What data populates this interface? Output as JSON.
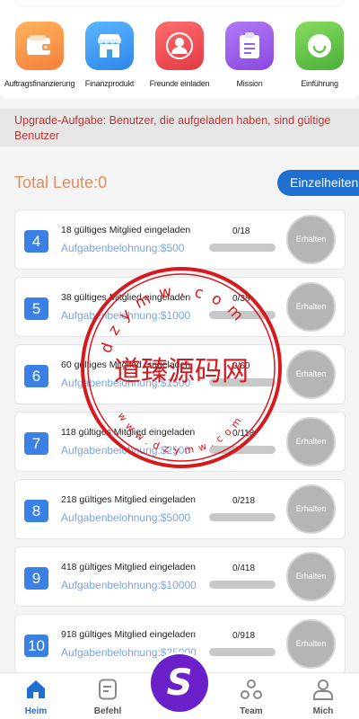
{
  "quick_actions": [
    {
      "label": "Auftragsfinanzierung",
      "icon": "wallet-icon",
      "color": "#f79a4a"
    },
    {
      "label": "Finanzprodukt",
      "icon": "store-icon",
      "color": "#3f9ef2"
    },
    {
      "label": "Freunde einladen",
      "icon": "person-icon",
      "color": "#ef4b52"
    },
    {
      "label": "Mission",
      "icon": "clipboard-icon",
      "color": "#9b5ce8"
    },
    {
      "label": "Einführung",
      "icon": "smile-icon",
      "color": "#62c24a"
    }
  ],
  "notice": "Upgrade-Aufgabe: Benutzer, die aufgeladen haben, sind gültige Benutzer",
  "total_label": "Total Leute:0",
  "details_label": "Einzelheiten",
  "tasks": [
    {
      "level": "4",
      "title": "18 gültiges Mitglied eingeladen",
      "reward": "Aufgabenbelohnung:$500",
      "progress": "0/18",
      "fraction": 0,
      "button": "Erhalten"
    },
    {
      "level": "5",
      "title": "38 gültiges Mitglied eingeladen",
      "reward": "Aufgabenbelohnung:$1000",
      "progress": "0/38",
      "fraction": 0,
      "button": "Erhalten"
    },
    {
      "level": "6",
      "title": "60 gültiges Mitglied eingeladen",
      "reward": "Aufgabenbelohnung:$1500",
      "progress": "0/60",
      "fraction": 0,
      "button": "Erhalten"
    },
    {
      "level": "7",
      "title": "118 gültiges Mitglied eingeladen",
      "reward": "Aufgabenbelohnung:$2500",
      "progress": "0/118",
      "fraction": 0,
      "button": "Erhalten"
    },
    {
      "level": "8",
      "title": "218 gültiges Mitglied eingeladen",
      "reward": "Aufgabenbelohnung:$5000",
      "progress": "0/218",
      "fraction": 0,
      "button": "Erhalten"
    },
    {
      "level": "9",
      "title": "418 gültiges Mitglied eingeladen",
      "reward": "Aufgabenbelohnung:$10000",
      "progress": "0/418",
      "fraction": 0,
      "button": "Erhalten"
    },
    {
      "level": "10",
      "title": "918 gültiges Mitglied eingeladen",
      "reward": "Aufgabenbelohnung:$25000",
      "progress": "0/918",
      "fraction": 0,
      "button": "Erhalten"
    }
  ],
  "watermark": {
    "text": "道臻源码网",
    "ring_top": "dzymw.com",
    "ring_bottom": "www.dzymw.com",
    "color": "#d6191e"
  },
  "nav": {
    "home": "Heim",
    "orders": "Befehl",
    "center": "S",
    "team": "Team",
    "me": "Mich"
  },
  "colors": {
    "accent": "#1f6fd1",
    "notice_text": "#c8312f",
    "total_text": "#e58a5c",
    "level_badge": "#3b80e4",
    "center_button": "#6b20c9"
  }
}
